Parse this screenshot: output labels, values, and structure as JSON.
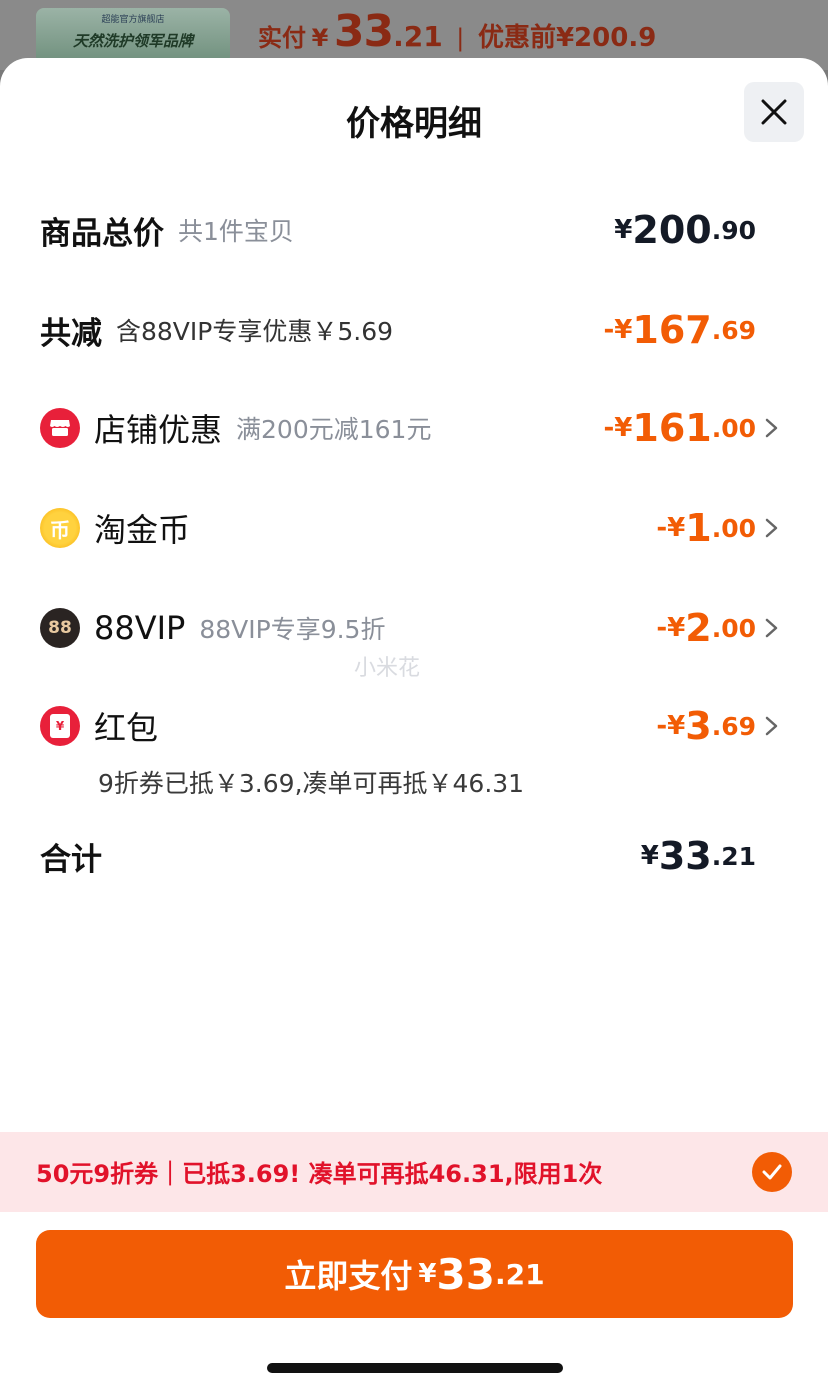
{
  "background": {
    "banner_brand": "超能官方旗舰店",
    "banner_slogan": "天然洗护领军品牌",
    "paid_label": "实付",
    "paid_currency": "¥",
    "paid_int": "33",
    "paid_dec": ".21",
    "separator": "|",
    "original_label": "优惠前",
    "original_price": "¥200.9"
  },
  "modal": {
    "title": "价格明细",
    "close_icon": "close-icon"
  },
  "rows": {
    "total_goods": {
      "label": "商品总价",
      "sub": "共1件宝贝",
      "pre": "¥",
      "int": "200",
      "dec": ".90"
    },
    "total_discount": {
      "label": "共减",
      "sub": "含88VIP专享优惠￥5.69",
      "pre": "-¥",
      "int": "167",
      "dec": ".69"
    },
    "shop_discount": {
      "label": "店铺优惠",
      "sub": "满200元减161元",
      "pre": "-¥",
      "int": "161",
      "dec": ".00",
      "icon": "shop-icon"
    },
    "taojinbi": {
      "label": "淘金币",
      "sub": "",
      "pre": "-¥",
      "int": "1",
      "dec": ".00",
      "icon": "coin-icon",
      "icon_text": "币"
    },
    "vip88": {
      "label": "88VIP",
      "sub": "88VIP专享9.5折",
      "pre": "-¥",
      "int": "2",
      "dec": ".00",
      "icon": "vip88-icon",
      "icon_text": "88"
    },
    "red_packet": {
      "label": "红包",
      "sub": "",
      "pre": "-¥",
      "int": "3",
      "dec": ".69",
      "icon": "red-packet-icon",
      "icon_text": "¥"
    },
    "red_packet_note": "9折券已抵￥3.69,凑单可再抵￥46.31",
    "sum": {
      "label": "合计",
      "pre": "¥",
      "int": "33",
      "dec": ".21"
    }
  },
  "watermark": "小米花",
  "coupon_bar": {
    "text": "50元9折券｜已抵3.69! 凑单可再抵46.31,限用1次",
    "check_icon": "check-icon"
  },
  "pay_button": {
    "label": "立即支付",
    "pre": "¥",
    "int": "33",
    "dec": ".21"
  },
  "colors": {
    "accent": "#f25c05",
    "coupon_text": "#e1122a",
    "coupon_bg": "#fde6e8",
    "shop_icon": "#e8203a"
  }
}
